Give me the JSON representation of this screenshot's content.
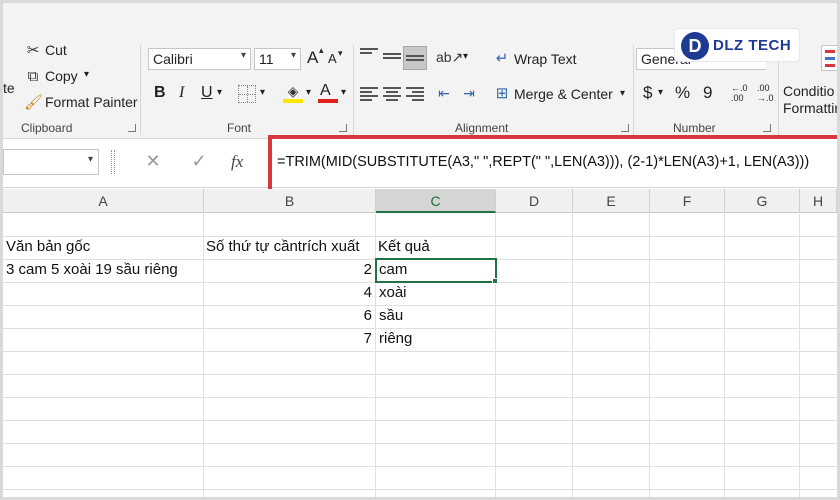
{
  "ribbon": {
    "clipboard": {
      "partial_label": "te",
      "cut_label": "Cut",
      "copy_label": "Copy",
      "format_painter_label": "Format Painter",
      "group_label": "Clipboard"
    },
    "font": {
      "name": "Calibri",
      "size": "11",
      "grow_label": "A",
      "shrink_label": "A",
      "bold": "B",
      "italic": "I",
      "underline": "U",
      "color_letter": "A",
      "group_label": "Font"
    },
    "alignment": {
      "wrap_text_label": "Wrap Text",
      "merge_center_label": "Merge & Center",
      "group_label": "Alignment"
    },
    "number": {
      "format_value": "General",
      "currency": "$",
      "percent": "%",
      "comma": "9",
      "inc_decimal": "←.0 .00",
      "dec_decimal": ".00 →.0",
      "group_label": "Number"
    },
    "styles": {
      "conditional_label_1": "Conditio",
      "conditional_label_2": "Formattin"
    },
    "logo_text": "DLZ TECH",
    "logo_letter": "D"
  },
  "formula_bar": {
    "fx_label": "fx",
    "formula": "=TRIM(MID(SUBSTITUTE(A3,\" \",REPT(\" \",LEN(A3))), (2-1)*LEN(A3)+1, LEN(A3)))"
  },
  "columns": [
    "A",
    "B",
    "C",
    "D",
    "E",
    "F",
    "G",
    "H"
  ],
  "sheet": {
    "a2": "Văn bản gốc",
    "b2": "Số thứ tự cầntrích xuất",
    "c2": "Kết quả",
    "a3": "3 cam 5 xoài 19 sầu riêng",
    "rows": [
      {
        "b": "2",
        "c": "cam"
      },
      {
        "b": "4",
        "c": "xoài"
      },
      {
        "b": "6",
        "c": "sầu"
      },
      {
        "b": "7",
        "c": "riêng"
      }
    ]
  },
  "colors": {
    "accent": "#217346",
    "highlight": "#d9363e",
    "logo": "#1f3a93"
  }
}
